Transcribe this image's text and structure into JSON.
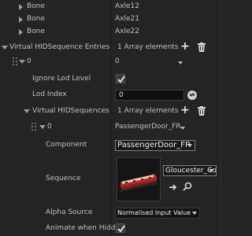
{
  "top_bones": [
    {
      "label": "Bone",
      "value": "Axle12"
    },
    {
      "label": "Bone",
      "value": "Axle21"
    },
    {
      "label": "Bone",
      "value": "Axle22"
    }
  ],
  "hid_entries": {
    "label": "Virtual HIDSequence Entries",
    "count": "1 Array elements"
  },
  "entry0": {
    "label": "0",
    "value": "0"
  },
  "ignore_lod": {
    "label": "Ignore Lod Level",
    "checked": true
  },
  "lod_index": {
    "label": "Lod Index",
    "value": "0"
  },
  "hid_sequences": {
    "label": "Virtual HIDSequences",
    "count": "1 Array elements"
  },
  "seq0": {
    "label": "0",
    "value": "PassengerDoor_FR"
  },
  "component": {
    "label": "Component",
    "value": "PassengerDoor_FR"
  },
  "sequence": {
    "label": "Sequence",
    "asset": "Gloucester_Co"
  },
  "alpha_source": {
    "label": "Alpha Source",
    "value": "Normalised Input Value"
  },
  "animate_hidden": {
    "label": "Animate when Hidden",
    "checked": true
  }
}
